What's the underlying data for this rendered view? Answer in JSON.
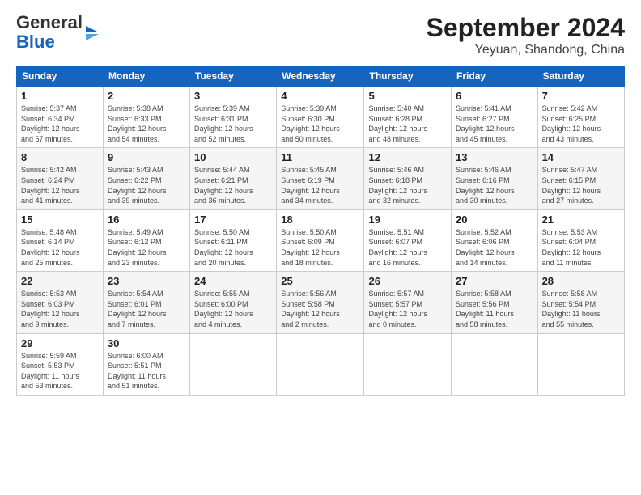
{
  "header": {
    "logo_general": "General",
    "logo_blue": "Blue",
    "title": "September 2024",
    "subtitle": "Yeyuan, Shandong, China"
  },
  "calendar": {
    "days_of_week": [
      "Sunday",
      "Monday",
      "Tuesday",
      "Wednesday",
      "Thursday",
      "Friday",
      "Saturday"
    ],
    "weeks": [
      [
        {
          "day": "1",
          "info": "Sunrise: 5:37 AM\nSunset: 6:34 PM\nDaylight: 12 hours\nand 57 minutes."
        },
        {
          "day": "2",
          "info": "Sunrise: 5:38 AM\nSunset: 6:33 PM\nDaylight: 12 hours\nand 54 minutes."
        },
        {
          "day": "3",
          "info": "Sunrise: 5:39 AM\nSunset: 6:31 PM\nDaylight: 12 hours\nand 52 minutes."
        },
        {
          "day": "4",
          "info": "Sunrise: 5:39 AM\nSunset: 6:30 PM\nDaylight: 12 hours\nand 50 minutes."
        },
        {
          "day": "5",
          "info": "Sunrise: 5:40 AM\nSunset: 6:28 PM\nDaylight: 12 hours\nand 48 minutes."
        },
        {
          "day": "6",
          "info": "Sunrise: 5:41 AM\nSunset: 6:27 PM\nDaylight: 12 hours\nand 45 minutes."
        },
        {
          "day": "7",
          "info": "Sunrise: 5:42 AM\nSunset: 6:25 PM\nDaylight: 12 hours\nand 43 minutes."
        }
      ],
      [
        {
          "day": "8",
          "info": "Sunrise: 5:42 AM\nSunset: 6:24 PM\nDaylight: 12 hours\nand 41 minutes."
        },
        {
          "day": "9",
          "info": "Sunrise: 5:43 AM\nSunset: 6:22 PM\nDaylight: 12 hours\nand 39 minutes."
        },
        {
          "day": "10",
          "info": "Sunrise: 5:44 AM\nSunset: 6:21 PM\nDaylight: 12 hours\nand 36 minutes."
        },
        {
          "day": "11",
          "info": "Sunrise: 5:45 AM\nSunset: 6:19 PM\nDaylight: 12 hours\nand 34 minutes."
        },
        {
          "day": "12",
          "info": "Sunrise: 5:46 AM\nSunset: 6:18 PM\nDaylight: 12 hours\nand 32 minutes."
        },
        {
          "day": "13",
          "info": "Sunrise: 5:46 AM\nSunset: 6:16 PM\nDaylight: 12 hours\nand 30 minutes."
        },
        {
          "day": "14",
          "info": "Sunrise: 5:47 AM\nSunset: 6:15 PM\nDaylight: 12 hours\nand 27 minutes."
        }
      ],
      [
        {
          "day": "15",
          "info": "Sunrise: 5:48 AM\nSunset: 6:14 PM\nDaylight: 12 hours\nand 25 minutes."
        },
        {
          "day": "16",
          "info": "Sunrise: 5:49 AM\nSunset: 6:12 PM\nDaylight: 12 hours\nand 23 minutes."
        },
        {
          "day": "17",
          "info": "Sunrise: 5:50 AM\nSunset: 6:11 PM\nDaylight: 12 hours\nand 20 minutes."
        },
        {
          "day": "18",
          "info": "Sunrise: 5:50 AM\nSunset: 6:09 PM\nDaylight: 12 hours\nand 18 minutes."
        },
        {
          "day": "19",
          "info": "Sunrise: 5:51 AM\nSunset: 6:07 PM\nDaylight: 12 hours\nand 16 minutes."
        },
        {
          "day": "20",
          "info": "Sunrise: 5:52 AM\nSunset: 6:06 PM\nDaylight: 12 hours\nand 14 minutes."
        },
        {
          "day": "21",
          "info": "Sunrise: 5:53 AM\nSunset: 6:04 PM\nDaylight: 12 hours\nand 11 minutes."
        }
      ],
      [
        {
          "day": "22",
          "info": "Sunrise: 5:53 AM\nSunset: 6:03 PM\nDaylight: 12 hours\nand 9 minutes."
        },
        {
          "day": "23",
          "info": "Sunrise: 5:54 AM\nSunset: 6:01 PM\nDaylight: 12 hours\nand 7 minutes."
        },
        {
          "day": "24",
          "info": "Sunrise: 5:55 AM\nSunset: 6:00 PM\nDaylight: 12 hours\nand 4 minutes."
        },
        {
          "day": "25",
          "info": "Sunrise: 5:56 AM\nSunset: 5:58 PM\nDaylight: 12 hours\nand 2 minutes."
        },
        {
          "day": "26",
          "info": "Sunrise: 5:57 AM\nSunset: 5:57 PM\nDaylight: 12 hours\nand 0 minutes."
        },
        {
          "day": "27",
          "info": "Sunrise: 5:58 AM\nSunset: 5:56 PM\nDaylight: 11 hours\nand 58 minutes."
        },
        {
          "day": "28",
          "info": "Sunrise: 5:58 AM\nSunset: 5:54 PM\nDaylight: 11 hours\nand 55 minutes."
        }
      ],
      [
        {
          "day": "29",
          "info": "Sunrise: 5:59 AM\nSunset: 5:53 PM\nDaylight: 11 hours\nand 53 minutes."
        },
        {
          "day": "30",
          "info": "Sunrise: 6:00 AM\nSunset: 5:51 PM\nDaylight: 11 hours\nand 51 minutes."
        },
        {
          "day": "",
          "info": ""
        },
        {
          "day": "",
          "info": ""
        },
        {
          "day": "",
          "info": ""
        },
        {
          "day": "",
          "info": ""
        },
        {
          "day": "",
          "info": ""
        }
      ]
    ]
  }
}
